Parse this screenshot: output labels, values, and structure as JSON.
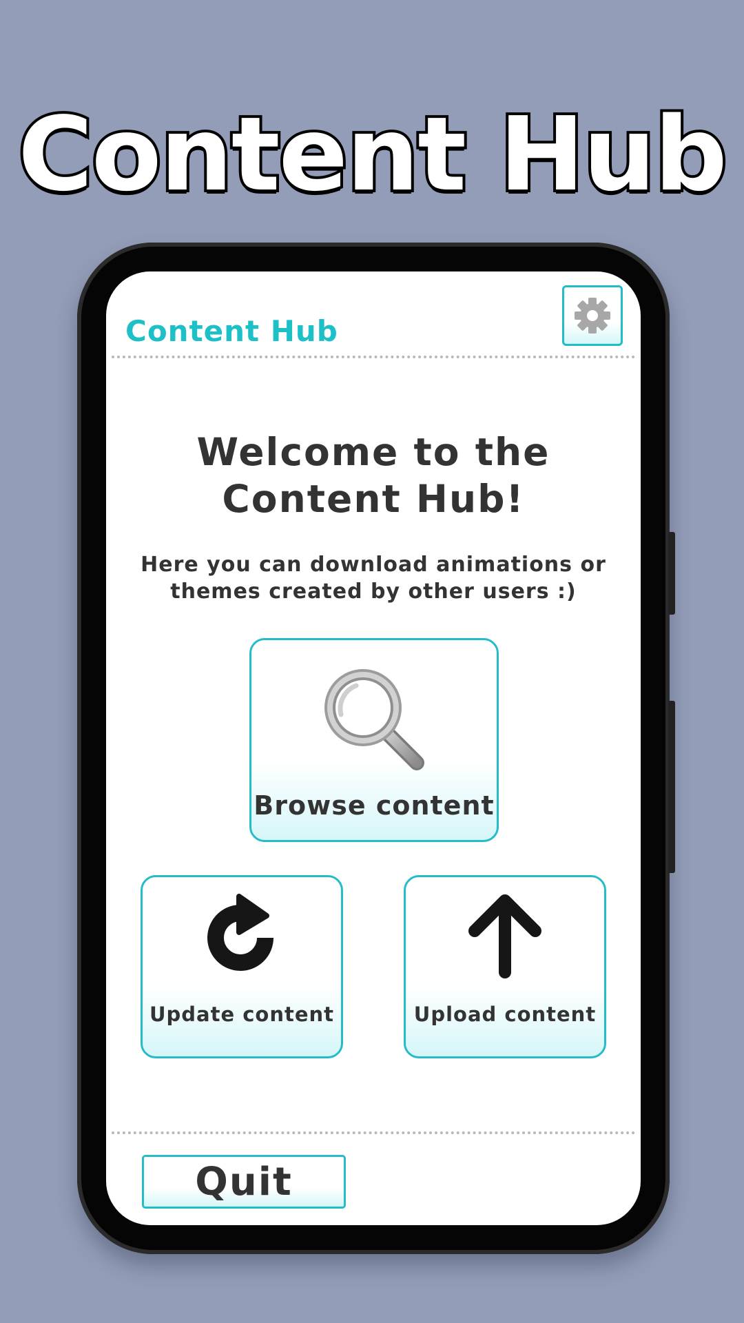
{
  "promo": {
    "title": "Content Hub"
  },
  "header": {
    "title": "Content Hub",
    "settings_icon": "gear-icon"
  },
  "welcome": {
    "title_line1": "Welcome to the",
    "title_line2": "Content Hub!",
    "description_line1": "Here you can download animations or",
    "description_line2": "themes created by other users :)"
  },
  "actions": {
    "browse": {
      "label": "Browse content",
      "icon": "magnifying-glass-icon"
    },
    "update": {
      "label": "Update content",
      "icon": "refresh-icon"
    },
    "upload": {
      "label": "Upload content",
      "icon": "upload-arrow-icon"
    }
  },
  "footer": {
    "quit_label": "Quit"
  },
  "colors": {
    "background": "#939db8",
    "accent": "#1ec0c8",
    "text": "#333333"
  }
}
